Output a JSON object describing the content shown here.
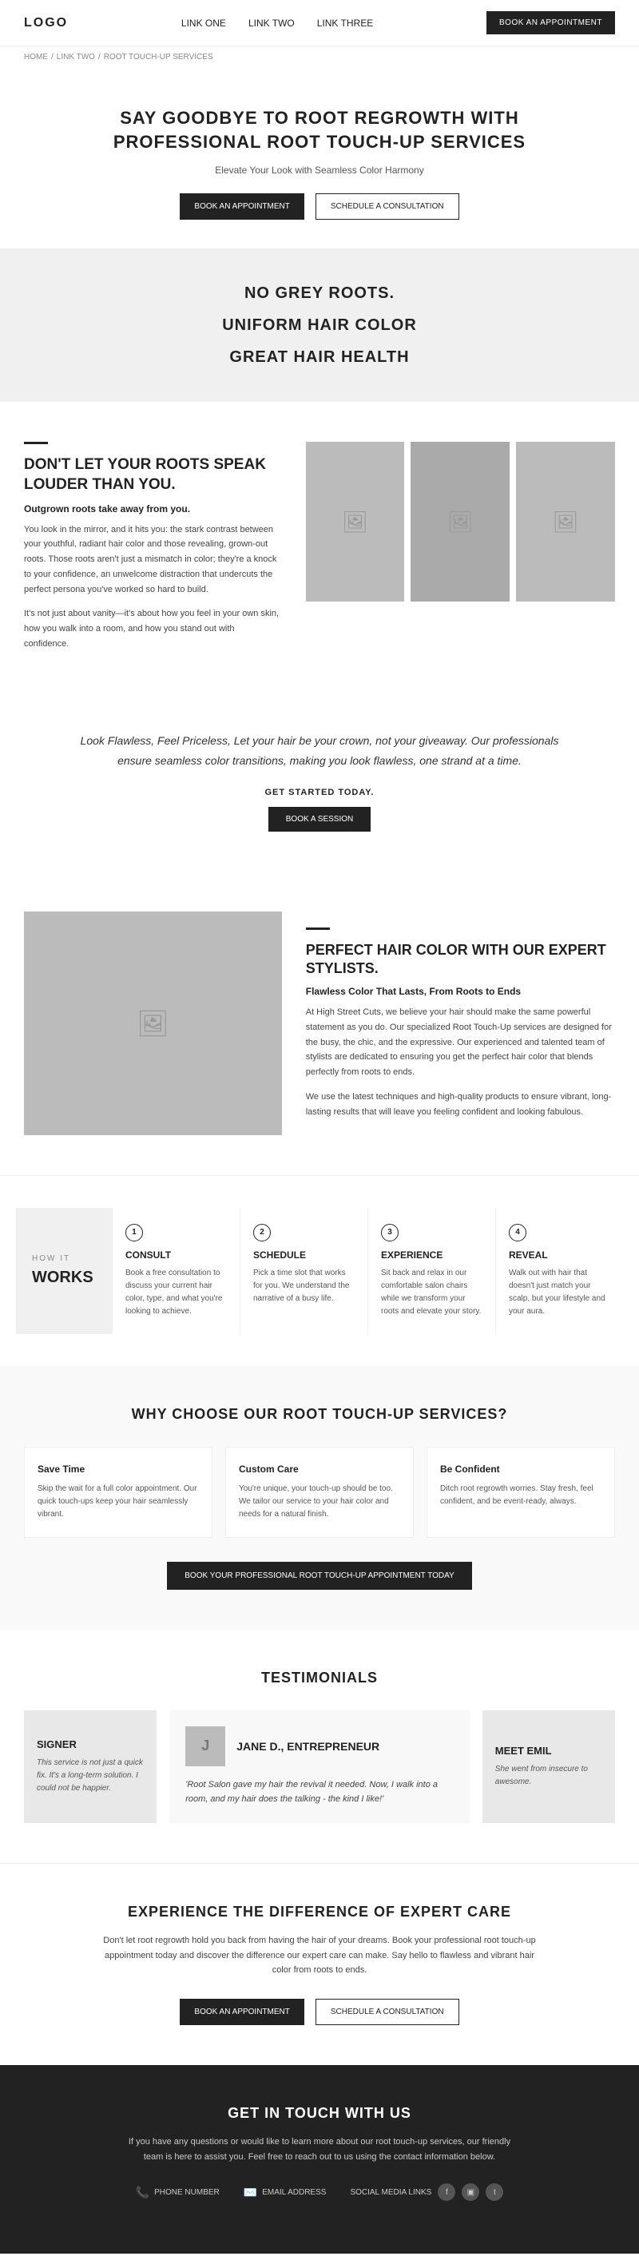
{
  "nav": {
    "logo": "LOGO",
    "link1": "LINK ONE",
    "link2": "LINK TWO",
    "link3": "LINK THREE",
    "book_btn": "BOOK AN APPOINTMENT"
  },
  "breadcrumb": {
    "home": "HOME",
    "sep": "/",
    "link_two": "LINK TWO",
    "sep2": "/",
    "current": "ROOT TOUCH-UP SERVICES"
  },
  "hero": {
    "heading": "SAY GOODBYE TO ROOT REGROWTH WITH PROFESSIONAL ROOT TOUCH-UP SERVICES",
    "subtext": "Elevate Your Look with Seamless Color Harmony",
    "btn_book": "BOOK AN APPOINTMENT",
    "btn_schedule": "SCHEDULE A CONSULTATION"
  },
  "benefits": {
    "line1": "NO GREY ROOTS.",
    "line2": "UNIFORM HAIR COLOR",
    "line3": "GREAT HAIR HEALTH"
  },
  "roots_section": {
    "accent_line": true,
    "heading": "DON'T LET YOUR ROOTS SPEAK LOUDER THAN YOU.",
    "subtitle": "Outgrown roots take away from you.",
    "para1": "You look in the mirror, and it hits you: the stark contrast between your youthful, radiant hair color and those revealing, grown-out roots. Those roots aren't just a mismatch in color; they're a knock to your confidence, an unwelcome distraction that undercuts the perfect persona you've worked so hard to build.",
    "para2": "It's not just about vanity—it's about how you feel in your own skin, how you walk into a room, and how you stand out with confidence."
  },
  "quote_section": {
    "quote": "Look Flawless, Feel Priceless, Let your hair be your crown, not your giveaway. Our professionals ensure seamless color transitions, making you look flawless, one strand at a time.",
    "cta_label": "GET STARTED TODAY.",
    "btn": "BOOK A SESSION"
  },
  "expert_section": {
    "accent_line": true,
    "heading": "PERFECT HAIR COLOR WITH OUR EXPERT STYLISTS.",
    "subtitle": "Flawless Color That Lasts, From Roots to Ends",
    "para1": "At High Street Cuts, we believe your hair should make the same powerful statement as you do. Our specialized Root Touch-Up services are designed for the busy, the chic, and the expressive. Our experienced and talented team of stylists are dedicated to ensuring you get the perfect hair color that blends perfectly from roots to ends.",
    "para2": "We use the latest techniques and high-quality products to ensure vibrant, long-lasting results that will leave you feeling confident and looking fabulous."
  },
  "how_it_works": {
    "label": "HOW IT",
    "title": "WORKS",
    "steps": [
      {
        "num": "1",
        "title": "Consult",
        "text": "Book a free consultation to discuss your current hair color, type, and what you're looking to achieve."
      },
      {
        "num": "2",
        "title": "Schedule",
        "text": "Pick a time slot that works for you. We understand the narrative of a busy life."
      },
      {
        "num": "3",
        "title": "Experience",
        "text": "Sit back and relax in our comfortable salon chairs while we transform your roots and elevate your story."
      },
      {
        "num": "4",
        "title": "Reveal",
        "text": "Walk out with hair that doesn't just match your scalp, but your lifestyle and your aura."
      }
    ]
  },
  "why_choose": {
    "heading": "WHY CHOOSE OUR ROOT TOUCH-UP SERVICES?",
    "cards": [
      {
        "title": "Save Time",
        "text": "Skip the wait for a full color appointment. Our quick touch-ups keep your hair seamlessly vibrant."
      },
      {
        "title": "Custom Care",
        "text": "You're unique, your touch-up should be too. We tailor our service to your hair color and needs for a natural finish."
      },
      {
        "title": "Be Confident",
        "text": "Ditch root regrowth worries. Stay fresh, feel confident, and be event-ready, always."
      }
    ],
    "btn": "BOOK YOUR PROFESSIONAL ROOT TOUCH-UP APPOINTMENT TODAY"
  },
  "testimonials": {
    "heading": "TESTIMONIALS",
    "left_name": "SIGNER",
    "left_text": "This service is not just a quick fix. It's a long-term solution. I could not be happier.",
    "main": {
      "name": "JANE D., ENTREPRENEUR",
      "quote": "'Root Salon gave my hair the revival it needed. Now, I walk into a room, and my hair does the talking - the kind I like!'",
      "avatar": "J"
    },
    "right_name": "MEET EMIL",
    "right_text": "She went from insecure to awesome."
  },
  "experience": {
    "heading": "EXPERIENCE THE DIFFERENCE OF EXPERT CARE",
    "text": "Don't let root regrowth hold you back from having the hair of your dreams. Book your professional root touch-up appointment today and discover the difference our expert care can make. Say hello to flawless and vibrant hair color from roots to ends.",
    "btn_book": "BOOK AN APPOINTMENT",
    "btn_schedule": "SCHEDULE A CONSULTATION"
  },
  "footer": {
    "heading": "GET IN TOUCH WITH US",
    "text": "If you have any questions or would like to learn more about our root touch-up services, our friendly team is here to assist you. Feel free to reach out to us using the contact information below.",
    "phone": "PHONE NUMBER",
    "email": "EMAIL ADDRESS",
    "social": "SOCIAL MEDIA LINKS"
  }
}
